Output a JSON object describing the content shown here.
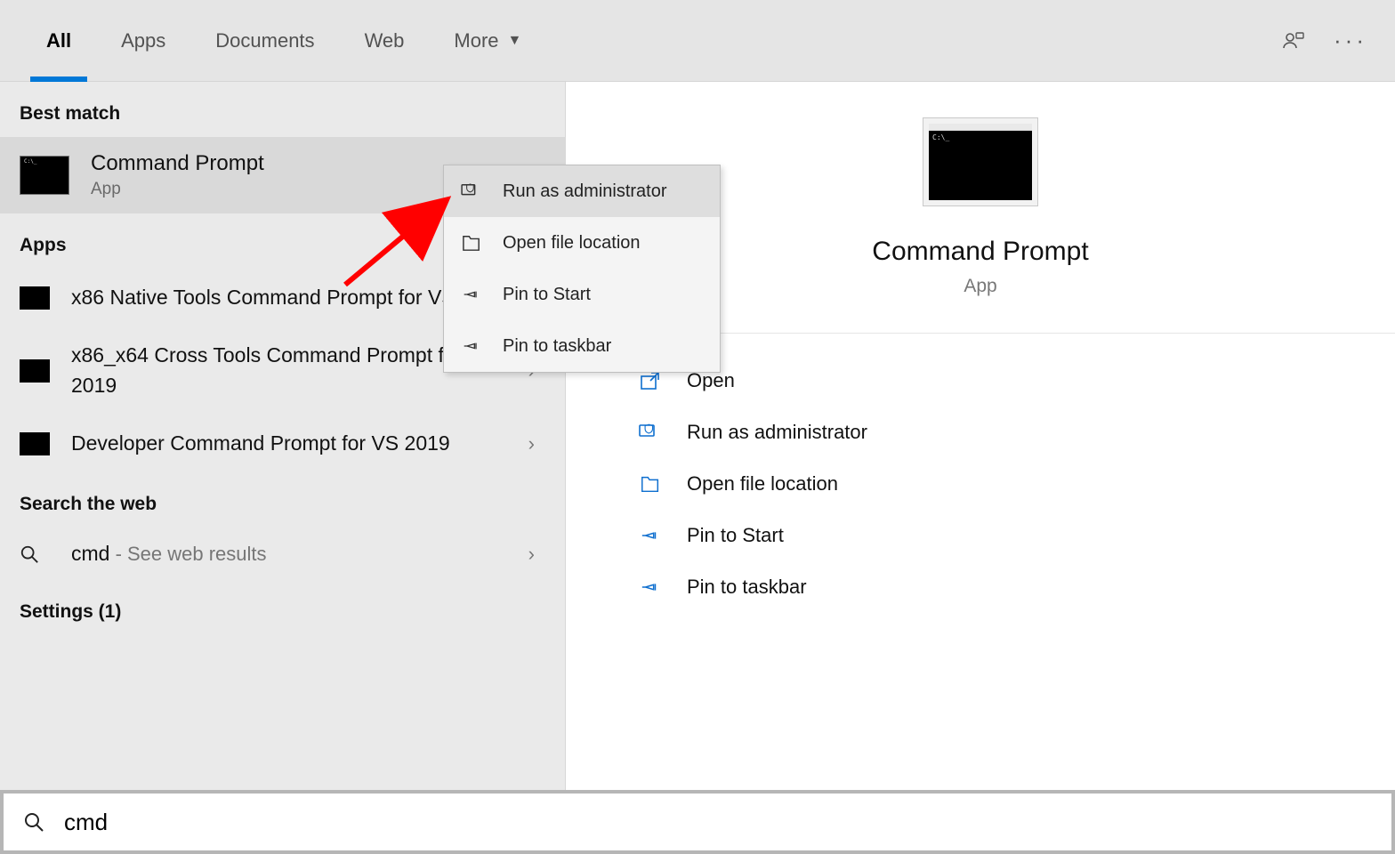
{
  "tabs": {
    "all": "All",
    "apps": "Apps",
    "documents": "Documents",
    "web": "Web",
    "more": "More"
  },
  "sections": {
    "best_match": "Best match",
    "apps": "Apps",
    "search_web": "Search the web",
    "settings": "Settings (1)"
  },
  "best_match": {
    "title": "Command Prompt",
    "subtitle": "App"
  },
  "app_results": [
    "x86 Native Tools Command Prompt for VS 2019",
    "x86_x64 Cross Tools Command Prompt for VS 2019",
    "Developer Command Prompt for VS 2019"
  ],
  "web_result": {
    "term": "cmd",
    "hint": " - See web results"
  },
  "detail": {
    "title": "Command Prompt",
    "subtitle": "App",
    "actions": [
      "Open",
      "Run as administrator",
      "Open file location",
      "Pin to Start",
      "Pin to taskbar"
    ]
  },
  "context_menu": [
    "Run as administrator",
    "Open file location",
    "Pin to Start",
    "Pin to taskbar"
  ],
  "search": {
    "value": "cmd"
  }
}
